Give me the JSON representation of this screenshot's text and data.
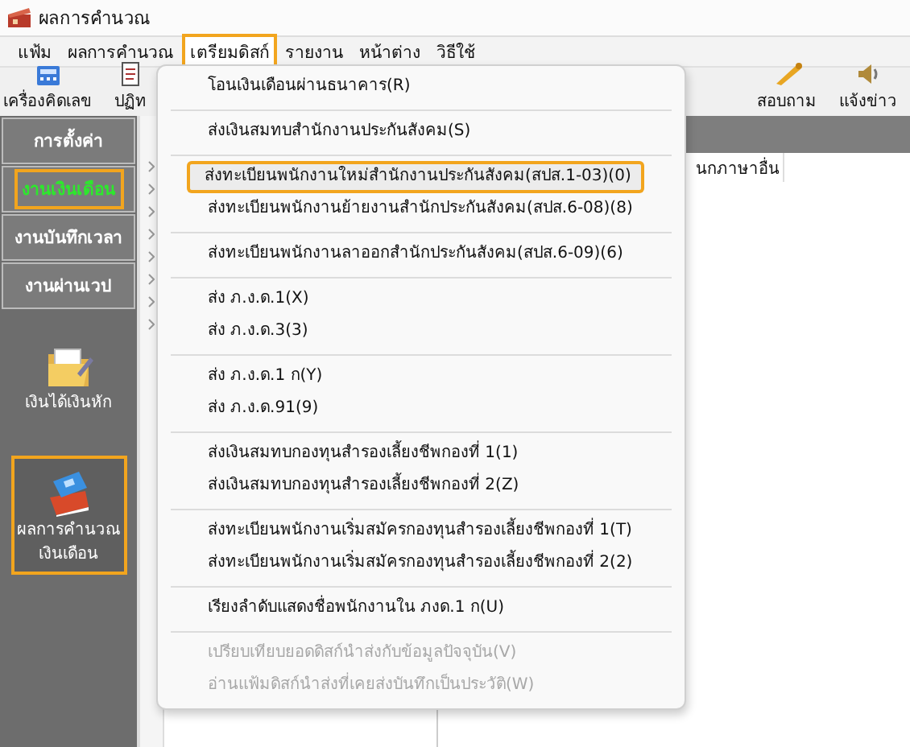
{
  "window": {
    "title": "ผลการคำนวณ"
  },
  "menu_bar": [
    {
      "label": "แฟ้ม",
      "selected": false
    },
    {
      "label": "ผลการคำนวณ",
      "selected": false
    },
    {
      "label": "เตรียมดิสก์",
      "selected": true
    },
    {
      "label": "รายงาน",
      "selected": false
    },
    {
      "label": "หน้าต่าง",
      "selected": false
    },
    {
      "label": "วิธีใช้",
      "selected": false
    }
  ],
  "toolbar": {
    "left": [
      {
        "label": "เครื่องคิดเลข",
        "kind": "calculator"
      },
      {
        "label": "ปฏิท",
        "kind": "calendar"
      }
    ],
    "right": [
      {
        "label": "สอบถาม",
        "kind": "pen"
      },
      {
        "label": "แจ้งข่าว",
        "kind": "speaker"
      }
    ]
  },
  "sidebar": {
    "tabs": [
      {
        "label": "การตั้งค่า",
        "selected": false
      },
      {
        "label": "งานเงินเดือน",
        "selected": true
      },
      {
        "label": "งานบันทึกเวลา",
        "selected": false
      },
      {
        "label": "งานผ่านเวป",
        "selected": false
      }
    ],
    "items": [
      {
        "lines": [
          "เงินได้เงินหัก"
        ],
        "kind": "folder",
        "selected": false
      },
      {
        "lines": [
          "ผลการคำนวณ",
          "เงินเดือน"
        ],
        "kind": "money",
        "selected": true
      }
    ]
  },
  "table": {
    "column_header": "นกภาษาอื่น"
  },
  "dropdown_menu": {
    "groups": [
      [
        {
          "label": "โอนเงินเดือนผ่านธนาคาร(R)",
          "selected": false,
          "disabled": false
        }
      ],
      [
        {
          "label": "ส่งเงินสมทบสำนักงานประกันสังคม(S)",
          "selected": false,
          "disabled": false
        }
      ],
      [
        {
          "label": "ส่งทะเบียนพนักงานใหม่สำนักงานประกันสังคม(สปส.1-03)(0)",
          "selected": true,
          "disabled": false
        },
        {
          "label": "ส่งทะเบียนพนักงานย้ายงานสำนักประกันสังคม(สปส.6-08)(8)",
          "selected": false,
          "disabled": false
        }
      ],
      [
        {
          "label": "ส่งทะเบียนพนักงานลาออกสำนักประกันสังคม(สปส.6-09)(6)",
          "selected": false,
          "disabled": false
        }
      ],
      [
        {
          "label": "ส่ง ภ.ง.ด.1(X)",
          "selected": false,
          "disabled": false
        },
        {
          "label": "ส่ง ภ.ง.ด.3(3)",
          "selected": false,
          "disabled": false
        }
      ],
      [
        {
          "label": "ส่ง ภ.ง.ด.1 ก(Y)",
          "selected": false,
          "disabled": false
        },
        {
          "label": "ส่ง ภ.ง.ด.91(9)",
          "selected": false,
          "disabled": false
        }
      ],
      [
        {
          "label": "ส่งเงินสมทบกองทุนสำรองเลี้ยงชีพกองที่ 1(1)",
          "selected": false,
          "disabled": false
        },
        {
          "label": "ส่งเงินสมทบกองทุนสำรองเลี้ยงชีพกองที่ 2(Z)",
          "selected": false,
          "disabled": false
        }
      ],
      [
        {
          "label": "ส่งทะเบียนพนักงานเริ่มสมัครกองทุนสำรองเลี้ยงชีพกองที่ 1(T)",
          "selected": false,
          "disabled": false
        },
        {
          "label": "ส่งทะเบียนพนักงานเริ่มสมัครกองทุนสำรองเลี้ยงชีพกองที่ 2(2)",
          "selected": false,
          "disabled": false
        }
      ],
      [
        {
          "label": "เรียงลำดับแสดงชื่อพนักงานใน  ภงด.1 ก(U)",
          "selected": false,
          "disabled": false
        }
      ],
      [
        {
          "label": "เปรียบเทียบยอดดิสก์นำส่งกับข้อมูลปัจจุบัน(V)",
          "selected": false,
          "disabled": true
        },
        {
          "label": "อ่านแฟ้มดิสก์นำส่งที่เคยส่งบันทึกเป็นประวัติ(W)",
          "selected": false,
          "disabled": true
        }
      ]
    ]
  }
}
